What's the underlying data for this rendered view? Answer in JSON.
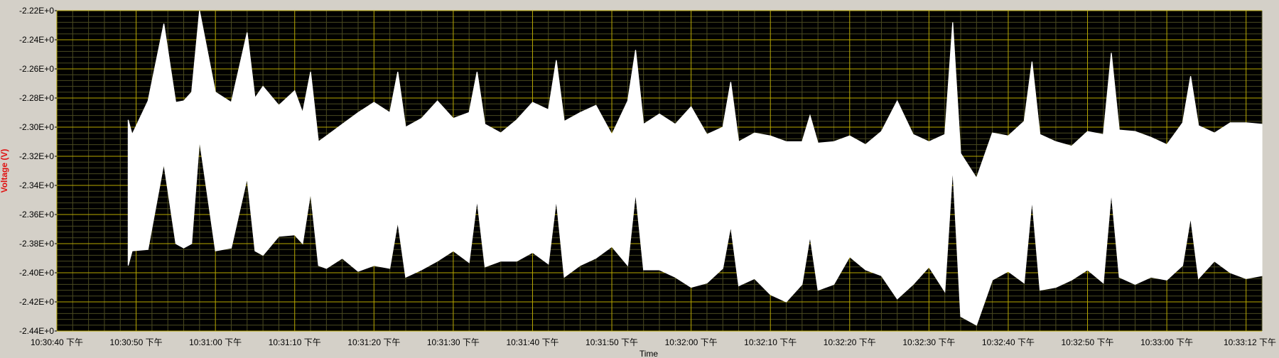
{
  "chart_data": {
    "type": "area",
    "ylabel": "Voltage (V)",
    "xlabel": "Time",
    "ylim": [
      -2.44,
      -2.22
    ],
    "y_ticks": [
      "-2.22E+0",
      "-2.24E+0",
      "-2.26E+0",
      "-2.28E+0",
      "-2.30E+0",
      "-2.32E+0",
      "-2.34E+0",
      "-2.36E+0",
      "-2.38E+0",
      "-2.40E+0",
      "-2.42E+0",
      "-2.44E+0"
    ],
    "x_ticks": [
      "10:30:40 下午",
      "10:30:50 下午",
      "10:31:00 下午",
      "10:31:10 下午",
      "10:31:20 下午",
      "10:31:30 下午",
      "10:31:40 下午",
      "10:31:50 下午",
      "10:32:00 下午",
      "10:32:10 下午",
      "10:32:20 下午",
      "10:32:30 下午",
      "10:32:40 下午",
      "10:32:50 下午",
      "10:33:00 下午",
      "10:33:12 下午"
    ],
    "x_seconds_range": [
      0,
      152
    ],
    "grid": true,
    "colors": {
      "plot_background": "#000000",
      "major_grid": "#b8a800",
      "minor_grid": "#4a4a20",
      "signal": "#ffffff",
      "frame": "#d4d0c8",
      "ylabel_color": "#e01010"
    },
    "series": [
      {
        "x": [
          9.0,
          9.5,
          11.5,
          13.5,
          15.0,
          16.0,
          17.0,
          18.0,
          20.0,
          22.0,
          24.0,
          25.0,
          26.0,
          28.0,
          30.0,
          31.0,
          32.0,
          33.0,
          34.0,
          36.0,
          38.0,
          40.0,
          42.0,
          43.0,
          44.0,
          46.0,
          48.0,
          50.0,
          52.0,
          53.0,
          54.0,
          56.0,
          58.0,
          60.0,
          62.0,
          63.0,
          64.0,
          66.0,
          68.0,
          70.0,
          72.0,
          73.0,
          74.0,
          76.0,
          78.0,
          80.0,
          82.0,
          84.0,
          85.0,
          86.0,
          88.0,
          90.0,
          92.0,
          94.0,
          95.0,
          96.0,
          98.0,
          100.0,
          102.0,
          104.0,
          106.0,
          108.0,
          110.0,
          112.0,
          113.0,
          114.0,
          116.0,
          118.0,
          120.0,
          122.0,
          123.0,
          124.0,
          126.0,
          128.0,
          130.0,
          132.0,
          133.0,
          134.0,
          136.0,
          138.0,
          140.0,
          142.0,
          143.0,
          144.0,
          146.0,
          148.0,
          150.0,
          152.0
        ],
        "upper": [
          -2.295,
          -2.305,
          -2.282,
          -2.229,
          -2.283,
          -2.282,
          -2.276,
          -2.22,
          -2.276,
          -2.283,
          -2.235,
          -2.28,
          -2.272,
          -2.285,
          -2.275,
          -2.29,
          -2.262,
          -2.31,
          -2.306,
          -2.298,
          -2.29,
          -2.283,
          -2.29,
          -2.262,
          -2.3,
          -2.294,
          -2.282,
          -2.294,
          -2.29,
          -2.262,
          -2.298,
          -2.304,
          -2.295,
          -2.283,
          -2.288,
          -2.254,
          -2.296,
          -2.29,
          -2.285,
          -2.305,
          -2.282,
          -2.247,
          -2.298,
          -2.291,
          -2.298,
          -2.286,
          -2.305,
          -2.3,
          -2.269,
          -2.31,
          -2.304,
          -2.306,
          -2.31,
          -2.31,
          -2.292,
          -2.311,
          -2.31,
          -2.306,
          -2.312,
          -2.303,
          -2.282,
          -2.305,
          -2.31,
          -2.305,
          -2.228,
          -2.318,
          -2.335,
          -2.304,
          -2.306,
          -2.296,
          -2.255,
          -2.305,
          -2.31,
          -2.313,
          -2.303,
          -2.305,
          -2.249,
          -2.302,
          -2.303,
          -2.307,
          -2.312,
          -2.297,
          -2.265,
          -2.299,
          -2.304,
          -2.297,
          -2.297,
          -2.298
        ],
        "lower": [
          -2.395,
          -2.385,
          -2.384,
          -2.325,
          -2.38,
          -2.383,
          -2.38,
          -2.309,
          -2.385,
          -2.383,
          -2.335,
          -2.385,
          -2.388,
          -2.375,
          -2.374,
          -2.38,
          -2.345,
          -2.395,
          -2.397,
          -2.39,
          -2.399,
          -2.395,
          -2.397,
          -2.365,
          -2.403,
          -2.398,
          -2.392,
          -2.385,
          -2.393,
          -2.35,
          -2.396,
          -2.392,
          -2.392,
          -2.386,
          -2.394,
          -2.35,
          -2.403,
          -2.395,
          -2.39,
          -2.382,
          -2.395,
          -2.345,
          -2.398,
          -2.398,
          -2.403,
          -2.41,
          -2.407,
          -2.397,
          -2.368,
          -2.409,
          -2.404,
          -2.415,
          -2.42,
          -2.408,
          -2.375,
          -2.412,
          -2.408,
          -2.389,
          -2.398,
          -2.402,
          -2.418,
          -2.408,
          -2.396,
          -2.413,
          -2.328,
          -2.43,
          -2.436,
          -2.405,
          -2.399,
          -2.407,
          -2.35,
          -2.412,
          -2.41,
          -2.405,
          -2.398,
          -2.407,
          -2.345,
          -2.403,
          -2.408,
          -2.403,
          -2.405,
          -2.395,
          -2.362,
          -2.404,
          -2.392,
          -2.4,
          -2.404,
          -2.402
        ]
      }
    ]
  }
}
